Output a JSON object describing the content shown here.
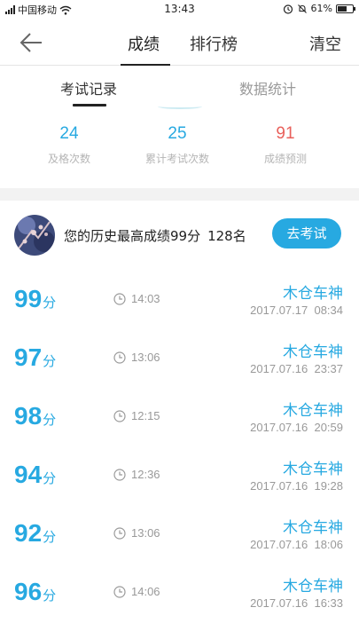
{
  "status_bar": {
    "carrier": "中国移动",
    "time": "13:43",
    "battery": "61%",
    "battery_level": 0.61
  },
  "nav": {
    "tabs": [
      "成绩",
      "排行榜"
    ],
    "active_tab": 0,
    "clear_label": "清空"
  },
  "sub_tabs": {
    "items": [
      "考试记录",
      "数据统计"
    ],
    "active": 0
  },
  "stats": [
    {
      "value": "24",
      "label": "及格次数",
      "color": "#27a9e1"
    },
    {
      "value": "25",
      "label": "累计考试次数",
      "color": "#27a9e1"
    },
    {
      "value": "91",
      "label": "成绩预测",
      "color": "#e9605b"
    }
  ],
  "best": {
    "text": "您的历史最高成绩99分",
    "rank": "128名",
    "button": "去考试"
  },
  "records": [
    {
      "score": "99",
      "unit": "分",
      "duration": "14:03",
      "name": "木仓车神",
      "date": "2017.07.17  08:34"
    },
    {
      "score": "97",
      "unit": "分",
      "duration": "13:06",
      "name": "木仓车神",
      "date": "2017.07.16  23:37"
    },
    {
      "score": "98",
      "unit": "分",
      "duration": "12:15",
      "name": "木仓车神",
      "date": "2017.07.16  20:59"
    },
    {
      "score": "94",
      "unit": "分",
      "duration": "12:36",
      "name": "木仓车神",
      "date": "2017.07.16  19:28"
    },
    {
      "score": "92",
      "unit": "分",
      "duration": "13:06",
      "name": "木仓车神",
      "date": "2017.07.16  18:06"
    },
    {
      "score": "96",
      "unit": "分",
      "duration": "14:06",
      "name": "木仓车神",
      "date": "2017.07.16  16:33"
    }
  ],
  "colors": {
    "accent": "#27a9e1",
    "prediction": "#e9605b"
  }
}
